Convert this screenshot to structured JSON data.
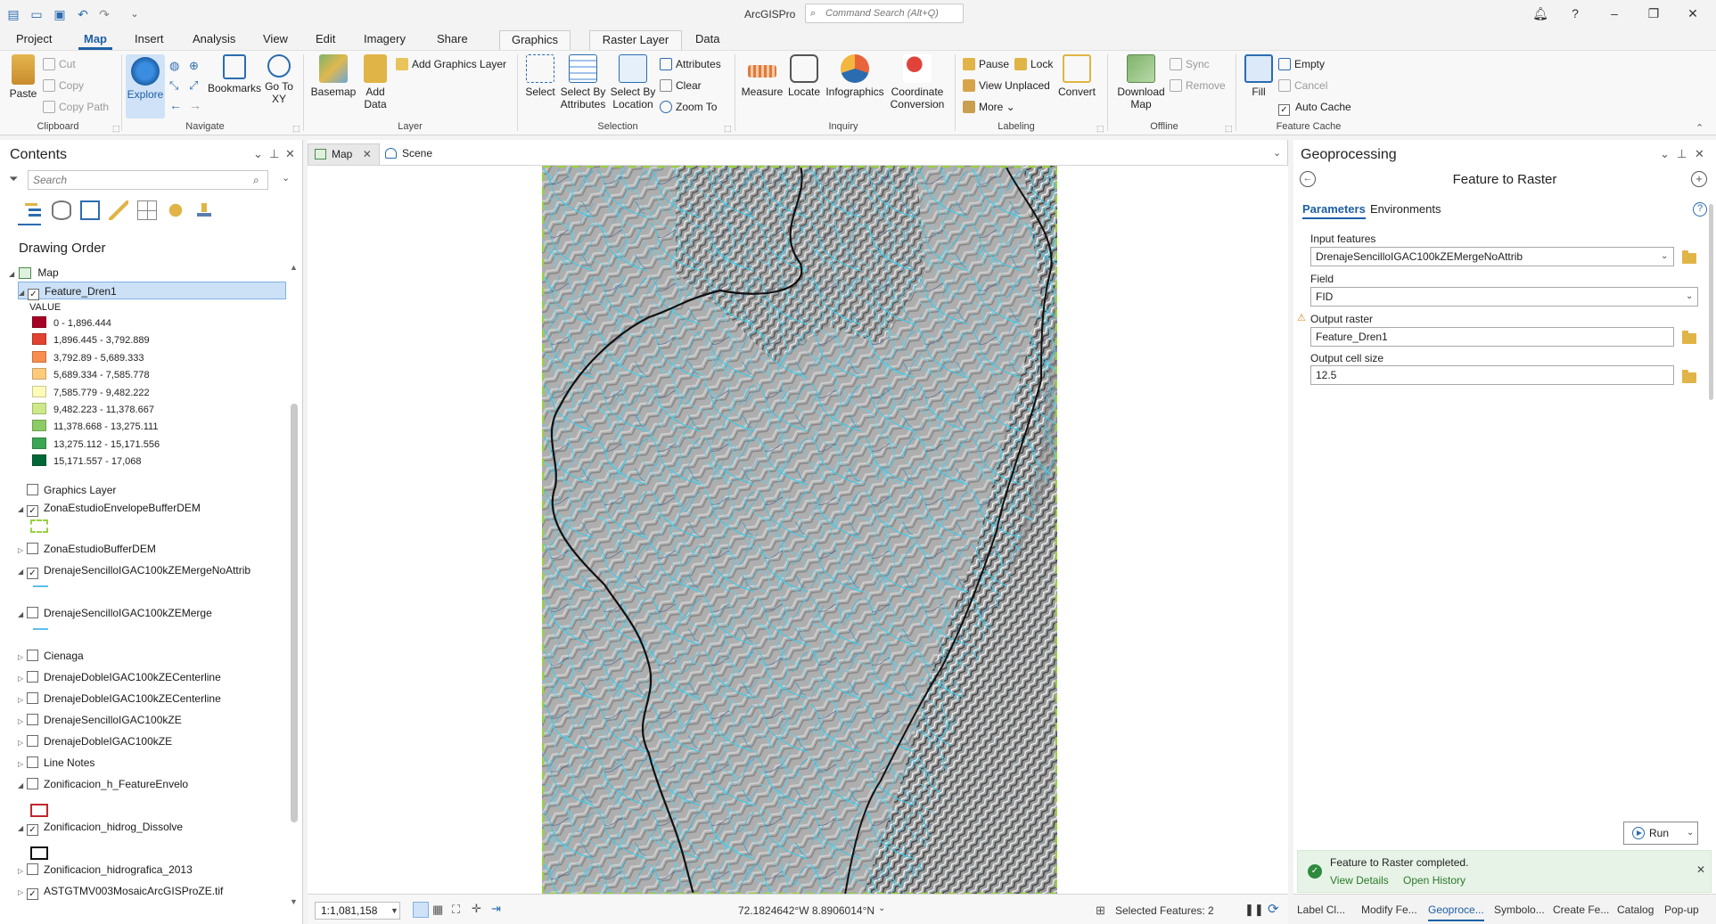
{
  "app": {
    "title": "ArcGISPro",
    "command_search_placeholder": "Command Search (Alt+Q)"
  },
  "ribbon_tabs": [
    "Project",
    "Map",
    "Insert",
    "Analysis",
    "View",
    "Edit",
    "Imagery",
    "Share",
    "Graphics",
    "Raster Layer",
    "Data"
  ],
  "ribbon": {
    "clipboard": {
      "label": "Clipboard",
      "paste": "Paste",
      "cut": "Cut",
      "copy": "Copy",
      "copy_path": "Copy Path"
    },
    "navigate": {
      "label": "Navigate",
      "explore": "Explore",
      "bookmarks": "Bookmarks",
      "go_to_xy": "Go To XY"
    },
    "layer": {
      "label": "Layer",
      "basemap": "Basemap",
      "add_data": "Add Data",
      "add_graphics_layer": "Add Graphics Layer"
    },
    "selection": {
      "label": "Selection",
      "select": "Select",
      "select_by_attributes": "Select By Attributes",
      "select_by_location": "Select By Location",
      "attributes": "Attributes",
      "clear": "Clear",
      "zoom_to": "Zoom To"
    },
    "inquiry": {
      "label": "Inquiry",
      "measure": "Measure",
      "locate": "Locate",
      "infographics": "Infographics",
      "coordinate_conversion": "Coordinate Conversion"
    },
    "labeling": {
      "label": "Labeling",
      "pause": "Pause",
      "lock": "Lock",
      "view_unplaced": "View Unplaced",
      "more": "More",
      "convert": "Convert"
    },
    "offline": {
      "label": "Offline",
      "download_map": "Download Map",
      "sync": "Sync",
      "remove": "Remove"
    },
    "feature_cache": {
      "label": "Feature Cache",
      "fill": "Fill",
      "empty": "Empty",
      "cancel": "Cancel",
      "auto_cache": "Auto Cache"
    }
  },
  "contents": {
    "title": "Contents",
    "search_placeholder": "Search",
    "drawing_order": "Drawing Order",
    "map_node": "Map",
    "layers": [
      {
        "name": "Feature_Dren1",
        "checked": true,
        "expanded": true,
        "selected": true
      },
      {
        "name": "Graphics Layer",
        "checked": false
      },
      {
        "name": "ZonaEstudioEnvelopeBufferDEM",
        "checked": true,
        "expanded": true
      },
      {
        "name": "ZonaEstudioBufferDEM",
        "checked": false
      },
      {
        "name": "DrenajeSencilloIGAC100kZEMergeNoAttrib",
        "checked": true,
        "expanded": true
      },
      {
        "name": "DrenajeSencilloIGAC100kZEMerge",
        "checked": false,
        "expanded": true
      },
      {
        "name": "Cienaga",
        "checked": false
      },
      {
        "name": "DrenajeDobleIGAC100kZECenterline",
        "checked": false
      },
      {
        "name": "DrenajeDobleIGAC100kZECenterline",
        "checked": false
      },
      {
        "name": "DrenajeSencilloIGAC100kZE",
        "checked": false
      },
      {
        "name": "DrenajeDobleIGAC100kZE",
        "checked": false
      },
      {
        "name": "Line Notes",
        "checked": false
      },
      {
        "name": "Zonificacion_h_FeatureEnvelo",
        "checked": false,
        "expanded": true
      },
      {
        "name": "Zonificacion_hidrog_Dissolve",
        "checked": true,
        "expanded": true
      },
      {
        "name": "Zonificacion_hidrografica_2013",
        "checked": false
      },
      {
        "name": "ASTGTMV003MosaicArcGISProZE.tif",
        "checked": true
      }
    ],
    "legend_title": "VALUE",
    "legend": [
      {
        "label": "0 - 1,896.444",
        "color": "#a50026"
      },
      {
        "label": "1,896.445 - 3,792.889",
        "color": "#e0432f"
      },
      {
        "label": "3,792.89 - 5,689.333",
        "color": "#f88d51"
      },
      {
        "label": "5,689.334 - 7,585.778",
        "color": "#fdcb7a"
      },
      {
        "label": "7,585.779 - 9,482.222",
        "color": "#fffcb9"
      },
      {
        "label": "9,482.223 - 11,378.667",
        "color": "#cde98a"
      },
      {
        "label": "11,378.668 - 13,275.111",
        "color": "#8ccb66"
      },
      {
        "label": "13,275.112 - 15,171.556",
        "color": "#3aa553"
      },
      {
        "label": "15,171.557 - 17,068",
        "color": "#006837"
      }
    ]
  },
  "map_view": {
    "tabs": [
      "Map",
      "Scene"
    ],
    "scale": "1:1,081,158",
    "coordinates": "72.1824642°W 8.8906014°N",
    "selected_features": "Selected Features: 2"
  },
  "geoprocessing": {
    "title": "Geoprocessing",
    "tool": "Feature to Raster",
    "tabs": [
      "Parameters",
      "Environments"
    ],
    "input_features_label": "Input features",
    "input_features_value": "DrenajeSencilloIGAC100kZEMergeNoAttrib",
    "field_label": "Field",
    "field_value": "FID",
    "output_raster_label": "Output raster",
    "output_raster_value": "Feature_Dren1",
    "cell_size_label": "Output cell size",
    "cell_size_value": "12.5",
    "run": "Run",
    "notice": "Feature to Raster completed.",
    "view_details": "View Details",
    "open_history": "Open History",
    "bottom_tabs": [
      "Label Cl...",
      "Modify Fe...",
      "Geoproce...",
      "Symbolo...",
      "Create Fe...",
      "Catalog",
      "Pop-up"
    ]
  }
}
